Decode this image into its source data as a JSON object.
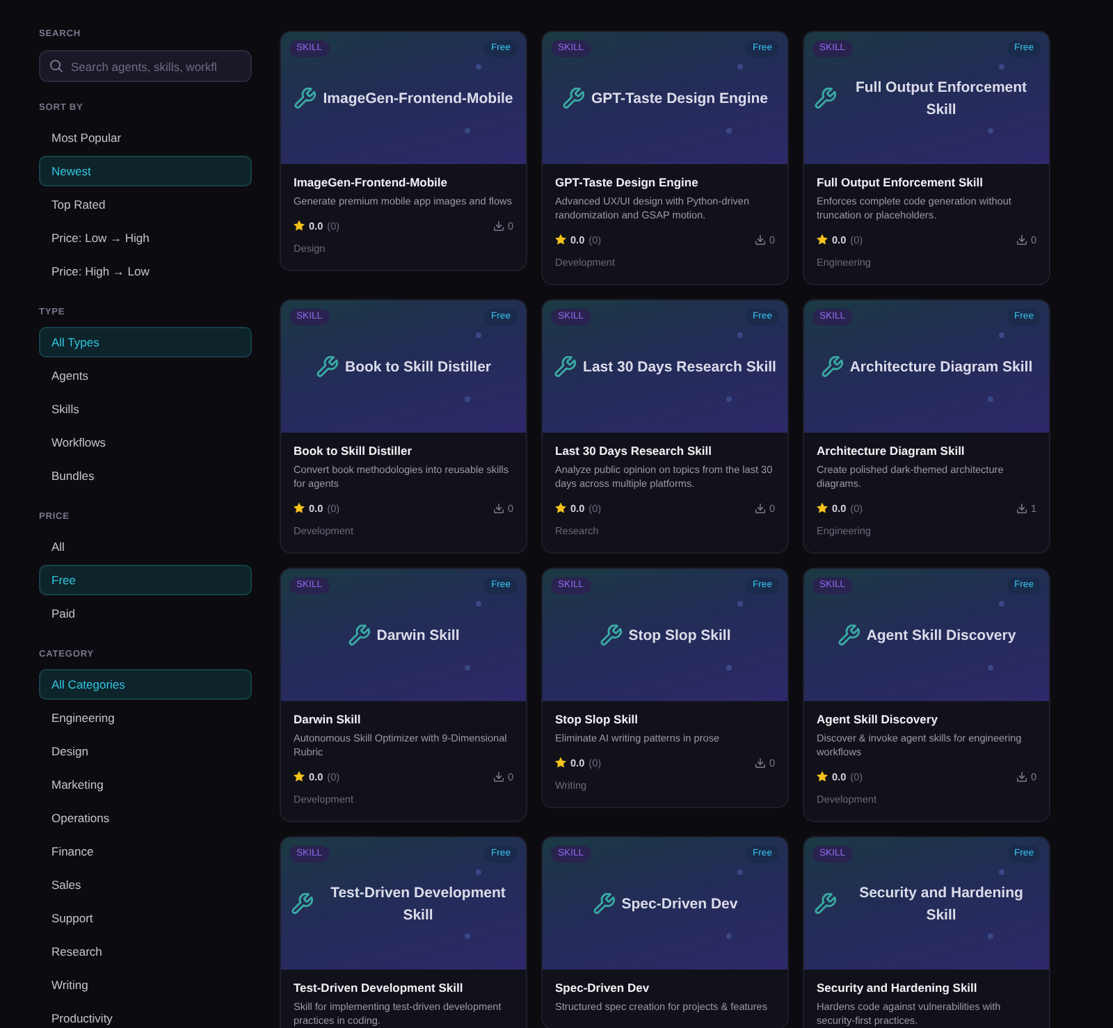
{
  "sidebar": {
    "search": {
      "label": "SEARCH",
      "placeholder": "Search agents, skills, workfl"
    },
    "sections": [
      {
        "title": "SORT BY",
        "items": [
          {
            "label": "Most Popular",
            "selected": false
          },
          {
            "label": "Newest",
            "selected": true
          },
          {
            "label": "Top Rated",
            "selected": false
          },
          {
            "label": "Price: Low → High",
            "selected": false
          },
          {
            "label": "Price: High → Low",
            "selected": false
          }
        ]
      },
      {
        "title": "TYPE",
        "items": [
          {
            "label": "All Types",
            "selected": true
          },
          {
            "label": "Agents",
            "selected": false
          },
          {
            "label": "Skills",
            "selected": false
          },
          {
            "label": "Workflows",
            "selected": false
          },
          {
            "label": "Bundles",
            "selected": false
          }
        ]
      },
      {
        "title": "PRICE",
        "items": [
          {
            "label": "All",
            "selected": false
          },
          {
            "label": "Free",
            "selected": true
          },
          {
            "label": "Paid",
            "selected": false
          }
        ]
      },
      {
        "title": "CATEGORY",
        "items": [
          {
            "label": "All Categories",
            "selected": true
          },
          {
            "label": "Engineering",
            "selected": false
          },
          {
            "label": "Design",
            "selected": false
          },
          {
            "label": "Marketing",
            "selected": false
          },
          {
            "label": "Operations",
            "selected": false
          },
          {
            "label": "Finance",
            "selected": false
          },
          {
            "label": "Sales",
            "selected": false
          },
          {
            "label": "Support",
            "selected": false
          },
          {
            "label": "Research",
            "selected": false
          },
          {
            "label": "Writing",
            "selected": false
          },
          {
            "label": "Productivity",
            "selected": false
          }
        ]
      }
    ]
  },
  "cards": [
    {
      "type": "SKILL",
      "price": "Free",
      "banner_title": "ImageGen-Frontend-Mobile",
      "title": "ImageGen-Frontend-Mobile",
      "description": "Generate premium mobile app images and flows",
      "rating": "0.0",
      "reviews": "(0)",
      "downloads": "0",
      "category": "Design"
    },
    {
      "type": "SKILL",
      "price": "Free",
      "banner_title": "GPT-Taste Design Engine",
      "title": "GPT-Taste Design Engine",
      "description": "Advanced UX/UI design with Python-driven randomization and GSAP motion.",
      "rating": "0.0",
      "reviews": "(0)",
      "downloads": "0",
      "category": "Development"
    },
    {
      "type": "SKILL",
      "price": "Free",
      "banner_title": "Full Output Enforcement Skill",
      "title": "Full Output Enforcement Skill",
      "description": "Enforces complete code generation without truncation or placeholders.",
      "rating": "0.0",
      "reviews": "(0)",
      "downloads": "0",
      "category": "Engineering"
    },
    {
      "type": "SKILL",
      "price": "Free",
      "banner_title": "Book to Skill Distiller",
      "title": "Book to Skill Distiller",
      "description": "Convert book methodologies into reusable skills for agents",
      "rating": "0.0",
      "reviews": "(0)",
      "downloads": "0",
      "category": "Development"
    },
    {
      "type": "SKILL",
      "price": "Free",
      "banner_title": "Last 30 Days Research Skill",
      "title": "Last 30 Days Research Skill",
      "description": "Analyze public opinion on topics from the last 30 days across multiple platforms.",
      "rating": "0.0",
      "reviews": "(0)",
      "downloads": "0",
      "category": "Research"
    },
    {
      "type": "SKILL",
      "price": "Free",
      "banner_title": "Architecture Diagram Skill",
      "title": "Architecture Diagram Skill",
      "description": "Create polished dark-themed architecture diagrams.",
      "rating": "0.0",
      "reviews": "(0)",
      "downloads": "1",
      "category": "Engineering"
    },
    {
      "type": "SKILL",
      "price": "Free",
      "banner_title": "Darwin Skill",
      "title": "Darwin Skill",
      "description": "Autonomous Skill Optimizer with 9-Dimensional Rubric",
      "rating": "0.0",
      "reviews": "(0)",
      "downloads": "0",
      "category": "Development"
    },
    {
      "type": "SKILL",
      "price": "Free",
      "banner_title": "Stop Slop Skill",
      "title": "Stop Slop Skill",
      "description": "Eliminate AI writing patterns in prose",
      "rating": "0.0",
      "reviews": "(0)",
      "downloads": "0",
      "category": "Writing"
    },
    {
      "type": "SKILL",
      "price": "Free",
      "banner_title": "Agent Skill Discovery",
      "title": "Agent Skill Discovery",
      "description": "Discover & invoke agent skills for engineering workflows",
      "rating": "0.0",
      "reviews": "(0)",
      "downloads": "0",
      "category": "Development"
    },
    {
      "type": "SKILL",
      "price": "Free",
      "banner_title": "Test-Driven Development Skill",
      "title": "Test-Driven Development Skill",
      "description": "Skill for implementing test-driven development practices in coding."
    },
    {
      "type": "SKILL",
      "price": "Free",
      "banner_title": "Spec-Driven Dev",
      "title": "Spec-Driven Dev",
      "description": "Structured spec creation for projects & features"
    },
    {
      "type": "SKILL",
      "price": "Free",
      "banner_title": "Security and Hardening Skill",
      "title": "Security and Hardening Skill",
      "description": "Hardens code against vulnerabilities with security-first practices."
    }
  ]
}
